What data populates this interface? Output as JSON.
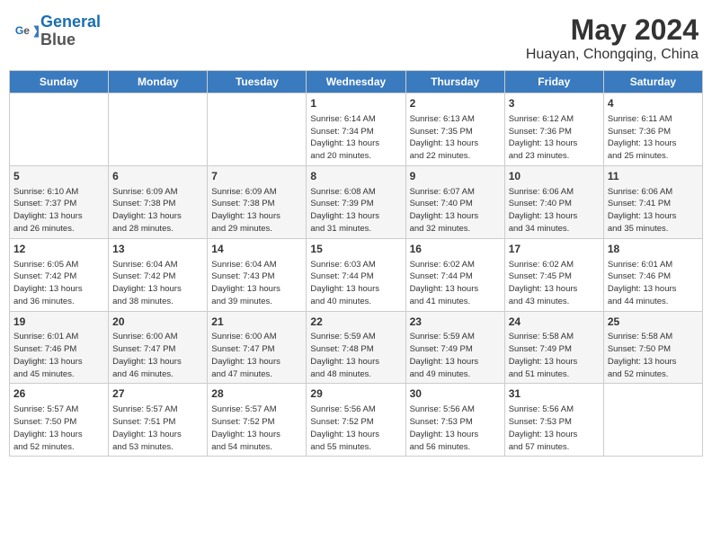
{
  "header": {
    "logo_line1": "General",
    "logo_line2": "Blue",
    "month_year": "May 2024",
    "location": "Huayan, Chongqing, China"
  },
  "weekdays": [
    "Sunday",
    "Monday",
    "Tuesday",
    "Wednesday",
    "Thursday",
    "Friday",
    "Saturday"
  ],
  "weeks": [
    [
      {
        "day": "",
        "info": ""
      },
      {
        "day": "",
        "info": ""
      },
      {
        "day": "",
        "info": ""
      },
      {
        "day": "1",
        "info": "Sunrise: 6:14 AM\nSunset: 7:34 PM\nDaylight: 13 hours\nand 20 minutes."
      },
      {
        "day": "2",
        "info": "Sunrise: 6:13 AM\nSunset: 7:35 PM\nDaylight: 13 hours\nand 22 minutes."
      },
      {
        "day": "3",
        "info": "Sunrise: 6:12 AM\nSunset: 7:36 PM\nDaylight: 13 hours\nand 23 minutes."
      },
      {
        "day": "4",
        "info": "Sunrise: 6:11 AM\nSunset: 7:36 PM\nDaylight: 13 hours\nand 25 minutes."
      }
    ],
    [
      {
        "day": "5",
        "info": "Sunrise: 6:10 AM\nSunset: 7:37 PM\nDaylight: 13 hours\nand 26 minutes."
      },
      {
        "day": "6",
        "info": "Sunrise: 6:09 AM\nSunset: 7:38 PM\nDaylight: 13 hours\nand 28 minutes."
      },
      {
        "day": "7",
        "info": "Sunrise: 6:09 AM\nSunset: 7:38 PM\nDaylight: 13 hours\nand 29 minutes."
      },
      {
        "day": "8",
        "info": "Sunrise: 6:08 AM\nSunset: 7:39 PM\nDaylight: 13 hours\nand 31 minutes."
      },
      {
        "day": "9",
        "info": "Sunrise: 6:07 AM\nSunset: 7:40 PM\nDaylight: 13 hours\nand 32 minutes."
      },
      {
        "day": "10",
        "info": "Sunrise: 6:06 AM\nSunset: 7:40 PM\nDaylight: 13 hours\nand 34 minutes."
      },
      {
        "day": "11",
        "info": "Sunrise: 6:06 AM\nSunset: 7:41 PM\nDaylight: 13 hours\nand 35 minutes."
      }
    ],
    [
      {
        "day": "12",
        "info": "Sunrise: 6:05 AM\nSunset: 7:42 PM\nDaylight: 13 hours\nand 36 minutes."
      },
      {
        "day": "13",
        "info": "Sunrise: 6:04 AM\nSunset: 7:42 PM\nDaylight: 13 hours\nand 38 minutes."
      },
      {
        "day": "14",
        "info": "Sunrise: 6:04 AM\nSunset: 7:43 PM\nDaylight: 13 hours\nand 39 minutes."
      },
      {
        "day": "15",
        "info": "Sunrise: 6:03 AM\nSunset: 7:44 PM\nDaylight: 13 hours\nand 40 minutes."
      },
      {
        "day": "16",
        "info": "Sunrise: 6:02 AM\nSunset: 7:44 PM\nDaylight: 13 hours\nand 41 minutes."
      },
      {
        "day": "17",
        "info": "Sunrise: 6:02 AM\nSunset: 7:45 PM\nDaylight: 13 hours\nand 43 minutes."
      },
      {
        "day": "18",
        "info": "Sunrise: 6:01 AM\nSunset: 7:46 PM\nDaylight: 13 hours\nand 44 minutes."
      }
    ],
    [
      {
        "day": "19",
        "info": "Sunrise: 6:01 AM\nSunset: 7:46 PM\nDaylight: 13 hours\nand 45 minutes."
      },
      {
        "day": "20",
        "info": "Sunrise: 6:00 AM\nSunset: 7:47 PM\nDaylight: 13 hours\nand 46 minutes."
      },
      {
        "day": "21",
        "info": "Sunrise: 6:00 AM\nSunset: 7:47 PM\nDaylight: 13 hours\nand 47 minutes."
      },
      {
        "day": "22",
        "info": "Sunrise: 5:59 AM\nSunset: 7:48 PM\nDaylight: 13 hours\nand 48 minutes."
      },
      {
        "day": "23",
        "info": "Sunrise: 5:59 AM\nSunset: 7:49 PM\nDaylight: 13 hours\nand 49 minutes."
      },
      {
        "day": "24",
        "info": "Sunrise: 5:58 AM\nSunset: 7:49 PM\nDaylight: 13 hours\nand 51 minutes."
      },
      {
        "day": "25",
        "info": "Sunrise: 5:58 AM\nSunset: 7:50 PM\nDaylight: 13 hours\nand 52 minutes."
      }
    ],
    [
      {
        "day": "26",
        "info": "Sunrise: 5:57 AM\nSunset: 7:50 PM\nDaylight: 13 hours\nand 52 minutes."
      },
      {
        "day": "27",
        "info": "Sunrise: 5:57 AM\nSunset: 7:51 PM\nDaylight: 13 hours\nand 53 minutes."
      },
      {
        "day": "28",
        "info": "Sunrise: 5:57 AM\nSunset: 7:52 PM\nDaylight: 13 hours\nand 54 minutes."
      },
      {
        "day": "29",
        "info": "Sunrise: 5:56 AM\nSunset: 7:52 PM\nDaylight: 13 hours\nand 55 minutes."
      },
      {
        "day": "30",
        "info": "Sunrise: 5:56 AM\nSunset: 7:53 PM\nDaylight: 13 hours\nand 56 minutes."
      },
      {
        "day": "31",
        "info": "Sunrise: 5:56 AM\nSunset: 7:53 PM\nDaylight: 13 hours\nand 57 minutes."
      },
      {
        "day": "",
        "info": ""
      }
    ]
  ]
}
